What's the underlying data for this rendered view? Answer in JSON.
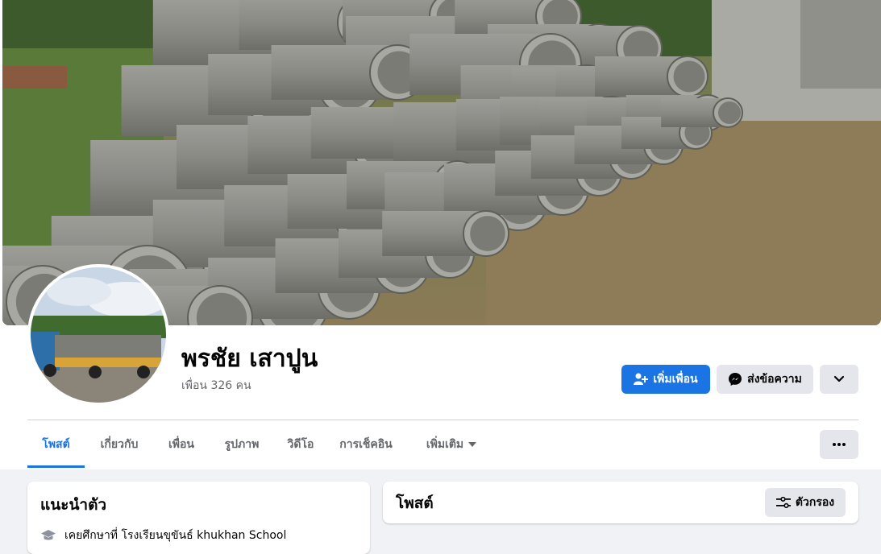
{
  "profile": {
    "name": "พรชัย เสาปูน",
    "friend_count": "เพื่อน 326 คน"
  },
  "actions": {
    "add_friend": "เพิ่มเพื่อน",
    "message": "ส่งข้อความ"
  },
  "tabs": [
    {
      "label": "โพสต์",
      "active": true
    },
    {
      "label": "เกี่ยวกับ"
    },
    {
      "label": "เพื่อน"
    },
    {
      "label": "รูปภาพ"
    },
    {
      "label": "วิดีโอ"
    },
    {
      "label": "การเช็คอิน"
    },
    {
      "label": "เพิ่มเติม"
    }
  ],
  "intro": {
    "title": "แนะนำตัว",
    "education": "เคยศึกษาที่ โรงเรียนขุขันธ์ khukhan School"
  },
  "posts": {
    "title": "โพสต์",
    "filter_label": "ตัวกรอง"
  },
  "colors": {
    "accent": "#1b74e4",
    "secondary_button": "#e4e6eb",
    "page_bg": "#f0f2f5"
  }
}
